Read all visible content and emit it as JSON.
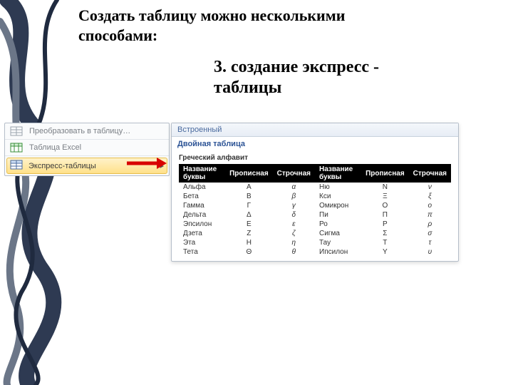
{
  "slide": {
    "heading": "Создать таблицу можно несколькими способами:",
    "subheading_l1": "3. создание экспресс -",
    "subheading_l2": "таблицы"
  },
  "word_menu": {
    "item_convert": "Преобразовать в таблицу…",
    "item_excel": "Таблица Excel",
    "item_express": "Экспресс-таблицы",
    "side_arrow": "▸"
  },
  "gallery": {
    "header": "Встроенный",
    "subheader": "Двойная таблица",
    "table_title": "Греческий алфавит"
  },
  "chart_data": {
    "type": "table",
    "title": "Греческий алфавит",
    "columns": [
      "Название буквы",
      "Прописная",
      "Строчная",
      "Название буквы",
      "Прописная",
      "Строчная"
    ],
    "rows": [
      [
        "Альфа",
        "A",
        "α",
        "Ню",
        "N",
        "ν"
      ],
      [
        "Бета",
        "B",
        "β",
        "Кси",
        "Ξ",
        "ξ"
      ],
      [
        "Гамма",
        "Γ",
        "γ",
        "Омикрон",
        "O",
        "o"
      ],
      [
        "Дельта",
        "Δ",
        "δ",
        "Пи",
        "Π",
        "π"
      ],
      [
        "Эпсилон",
        "E",
        "ε",
        "Ро",
        "P",
        "ρ"
      ],
      [
        "Дзета",
        "Z",
        "ζ",
        "Сигма",
        "Σ",
        "σ"
      ],
      [
        "Эта",
        "H",
        "η",
        "Тау",
        "T",
        "τ"
      ],
      [
        "Тета",
        "Θ",
        "θ",
        "Ипсилон",
        "Y",
        "υ"
      ]
    ]
  }
}
